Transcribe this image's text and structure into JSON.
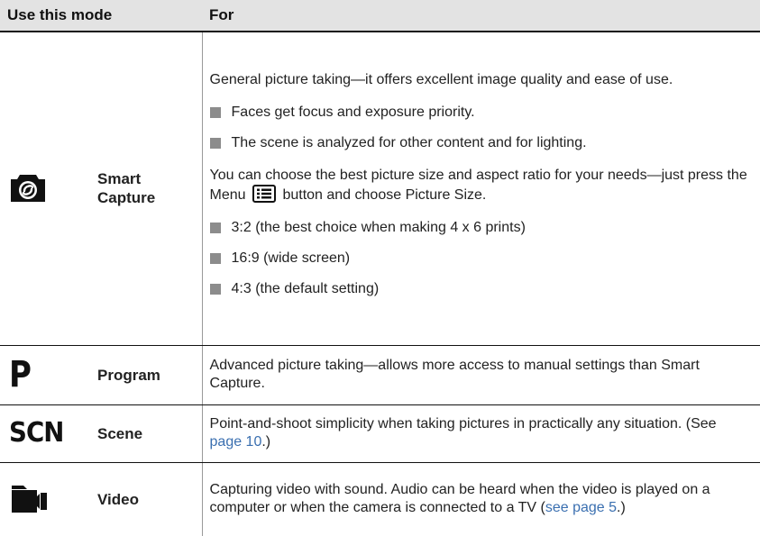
{
  "table": {
    "headers": {
      "mode": "Use this mode",
      "for": "For"
    },
    "rows": {
      "smart": {
        "icon": "camera-icon",
        "name_line1": "Smart",
        "name_line2": "Capture",
        "intro": "General picture taking—it offers excellent image quality and ease of use.",
        "bullets1": [
          "Faces get focus and exposure priority.",
          "The scene is analyzed for other content and for lighting."
        ],
        "para2_before": "You can choose the best picture size and aspect ratio for your needs—just press the Menu",
        "menu_icon": "menu-list-icon",
        "para2_after": "button and choose Picture Size.",
        "bullets2": [
          "3:2 (the best choice when making 4 x 6 prints)",
          "16:9 (wide screen)",
          "4:3 (the default setting)"
        ]
      },
      "program": {
        "icon_text": "P",
        "name": "Program",
        "desc": "Advanced picture taking—allows more access to manual settings than Smart Capture."
      },
      "scene": {
        "icon_text": "SCN",
        "name": "Scene",
        "desc_before": "Point-and-shoot simplicity when taking pictures in practically any situation. (See ",
        "link": "page 10",
        "desc_after": ".)"
      },
      "video": {
        "icon": "video-camera-icon",
        "name": "Video",
        "desc_before": "Capturing video with sound. Audio can be heard when the video is played on a computer or when the camera is connected to a TV (",
        "link": "see page 5",
        "desc_after": ".)"
      }
    }
  },
  "colors": {
    "header_bg": "#e3e3e3",
    "link": "#3a6fb0",
    "bullet": "#8c8c8c"
  }
}
